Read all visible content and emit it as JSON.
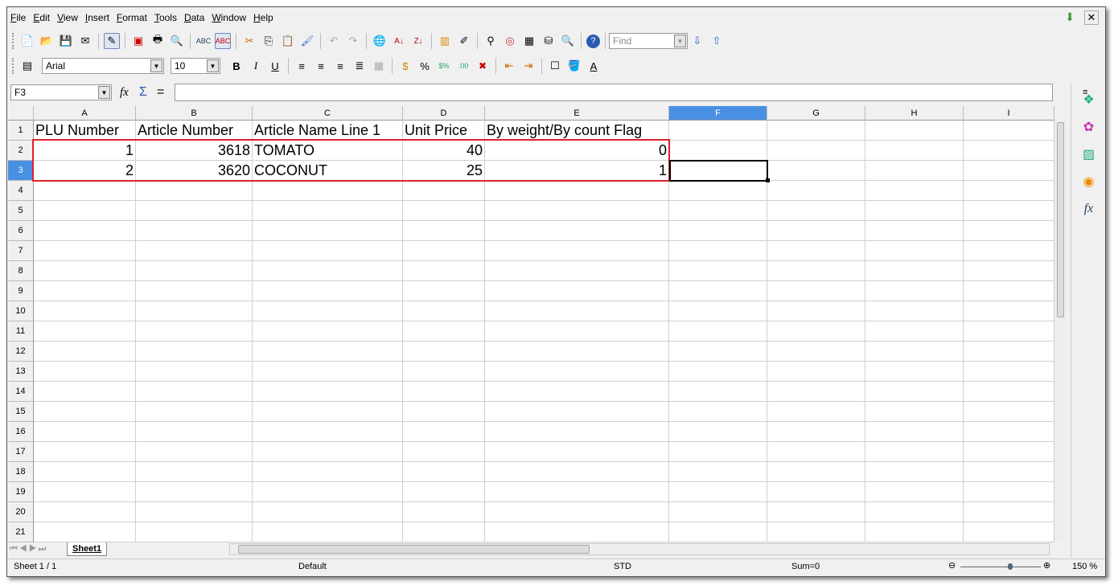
{
  "menu": [
    "File",
    "Edit",
    "View",
    "Insert",
    "Format",
    "Tools",
    "Data",
    "Window",
    "Help"
  ],
  "toolbar": {
    "find_placeholder": "Find",
    "font_name": "Arial",
    "font_size": "10",
    "bold": "B",
    "italic": "I",
    "underline": "U",
    "percent": "%"
  },
  "formula": {
    "name_box": "F3",
    "value": ""
  },
  "columns": [
    "A",
    "B",
    "C",
    "D",
    "E",
    "F",
    "G",
    "H",
    "I"
  ],
  "rows": [
    "1",
    "2",
    "3",
    "4",
    "5",
    "6",
    "7",
    "8",
    "9",
    "10",
    "11",
    "12",
    "13",
    "14",
    "15",
    "16",
    "17",
    "18",
    "19",
    "20",
    "21"
  ],
  "cells": [
    [
      "PLU Number",
      "Article Number",
      "Article Name Line 1",
      "Unit Price",
      "By weight/By count Flag"
    ],
    [
      "1",
      "3618",
      "TOMATO",
      "40",
      "0"
    ],
    [
      "2",
      "3620",
      "COCONUT",
      "25",
      "1"
    ]
  ],
  "selected_cell": "F3",
  "highlight_color": "#e0202a",
  "sheet_tab": "Sheet1",
  "status": {
    "sheet": "Sheet 1 / 1",
    "style": "Default",
    "mode": "STD",
    "sum": "Sum=0",
    "zoom": "150 %"
  }
}
